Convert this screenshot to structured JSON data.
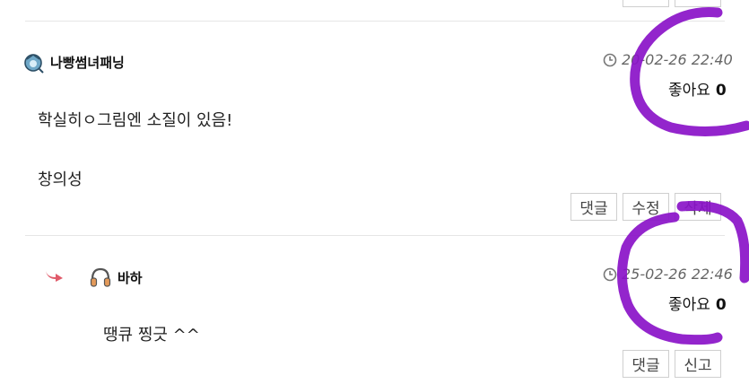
{
  "comments": [
    {
      "author": "나빵썸녀패닝",
      "date": "20-02-26 22:40",
      "likes_label": "좋아요",
      "likes_count": "0",
      "line1": "학실히ㅇ그림엔 소질이 있음!",
      "line2": "창의성",
      "buttons": {
        "reply": "댓글",
        "edit": "수정",
        "delete": "삭제"
      }
    },
    {
      "author": "바하",
      "date": "25-02-26 22:46",
      "likes_label": "좋아요",
      "likes_count": "0",
      "line1": "땡큐 찡긋 ^^",
      "buttons": {
        "reply": "댓글",
        "report": "신고"
      }
    }
  ],
  "colors": {
    "highlight": "#8a12c8",
    "reply_arrow": "#e05a6a"
  }
}
